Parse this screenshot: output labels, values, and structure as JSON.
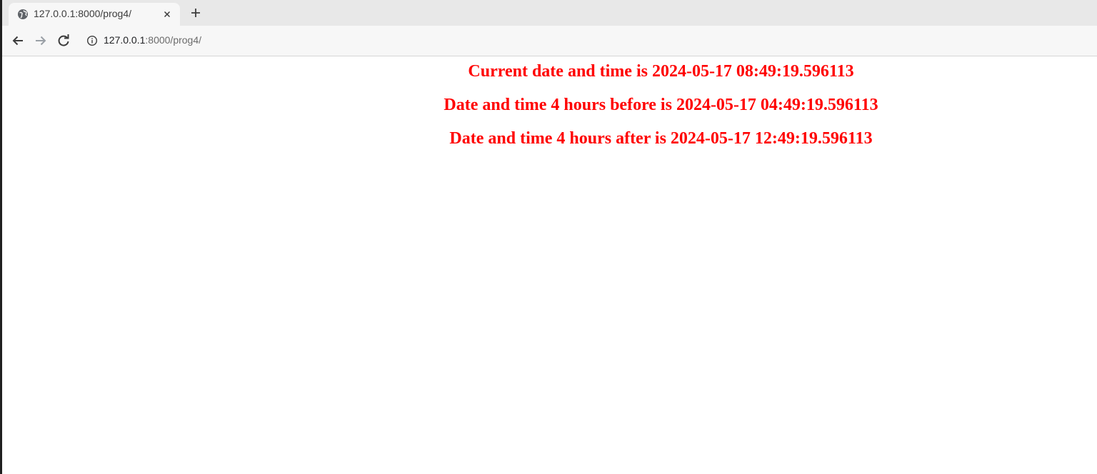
{
  "browser": {
    "tab": {
      "title": "127.0.0.1:8000/prog4/",
      "favicon": "globe-icon"
    },
    "new_tab_icon": "plus-icon",
    "toolbar": {
      "back_icon": "arrow-left-icon",
      "forward_icon": "arrow-right-icon",
      "reload_icon": "reload-icon",
      "info_icon": "info-icon"
    },
    "address": {
      "host": "127.0.0.1",
      "rest": ":8000/prog4/"
    }
  },
  "page": {
    "text_color": "#ff0000",
    "lines": [
      "Current date and time is 2024-05-17 08:49:19.596113",
      "Date and time 4 hours before is 2024-05-17 04:49:19.596113",
      "Date and time 4 hours after is 2024-05-17 12:49:19.596113"
    ]
  }
}
